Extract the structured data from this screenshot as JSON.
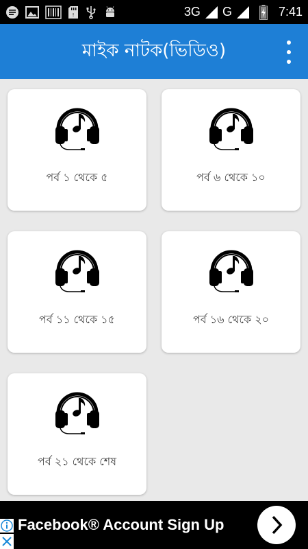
{
  "status_bar": {
    "network_3g": "3G",
    "network_g": "G",
    "time": "7:41",
    "icons": [
      "message-icon",
      "image-icon",
      "barcode-icon",
      "sd-card-icon",
      "usb-icon",
      "android-icon",
      "signal-icon",
      "battery-icon"
    ]
  },
  "app_bar": {
    "title": "মাইক নাটক(ভিডিও)",
    "menu_icon": "overflow-menu-icon"
  },
  "cards": [
    {
      "label": "পর্ব ১ থেকে ৫",
      "icon": "headphones-music-icon"
    },
    {
      "label": "পর্ব ৬ থেকে ১০",
      "icon": "headphones-music-icon"
    },
    {
      "label": "পর্ব ১১ থেকে ১৫",
      "icon": "headphones-music-icon"
    },
    {
      "label": "পর্ব ১৬ থেকে ২০",
      "icon": "headphones-music-icon"
    },
    {
      "label": "পর্ব ২১ থেকে শেষ",
      "icon": "headphones-music-icon"
    }
  ],
  "ad": {
    "text": "Facebook® Account Sign Up",
    "icons": [
      "info-icon",
      "close-icon",
      "chevron-right-icon"
    ]
  },
  "colors": {
    "app_bar": "#1e7fd6",
    "background": "#e9e9e9",
    "card": "#ffffff",
    "ad_background": "#000000",
    "ad_accent": "#1a8ad9"
  }
}
